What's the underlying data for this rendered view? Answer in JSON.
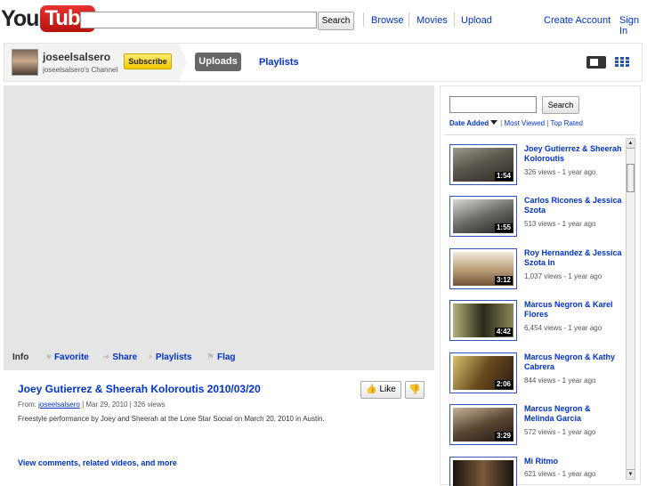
{
  "header": {
    "logo_you": "You",
    "logo_tube": "Tube",
    "search_button": "Search",
    "nav": [
      "Browse",
      "Movies",
      "Upload"
    ],
    "create_account": "Create Account",
    "sign_in": "Sign In"
  },
  "channel": {
    "name": "joseelsalsero",
    "subtitle": "joseelsalsero's Channel",
    "subscribe": "Subscribe",
    "uploads_tab": "Uploads",
    "playlists_tab": "Playlists"
  },
  "video_tabs": {
    "info": "Info",
    "favorite": "Favorite",
    "share": "Share",
    "playlists": "Playlists",
    "flag": "Flag"
  },
  "video": {
    "title": "Joey Gutierrez & Sheerah Koloroutis 2010/03/20",
    "like": "Like",
    "from_label": "From:",
    "from_user": "joseelsalsero",
    "date": "| Mar 29, 2010 | 326 views",
    "description": "Freestyle performance by Joey and Sheerah at the Lone Star Social on March 20, 2010 in Austin.",
    "more_link": "View comments, related videos, and more"
  },
  "sidebar": {
    "search_button": "Search",
    "sort_active": "Date Added",
    "sort_most_viewed": "Most Viewed",
    "sort_top_rated": "Top Rated",
    "sort_sep": "|",
    "items": [
      {
        "title": "Joey Gutierrez & Sheerah Koloroutis",
        "meta": "326 views - 1 year ago",
        "duration": "1:54"
      },
      {
        "title": "Carlos Ricones & Jessica Szota",
        "meta": "513 views - 1 year ago",
        "duration": "1:55"
      },
      {
        "title": "Roy Hernandez & Jessica Szota In",
        "meta": "1,037 views - 1 year ago",
        "duration": "3:12"
      },
      {
        "title": "Marcus Negron & Karel Flores",
        "meta": "6,454 views - 1 year ago",
        "duration": "4:42"
      },
      {
        "title": "Marcus Negron & Kathy Cabrera",
        "meta": "844 views - 1 year ago",
        "duration": "2:06"
      },
      {
        "title": "Marcus Negron & Melinda Garcia",
        "meta": "572 views - 1 year ago",
        "duration": "3:29"
      },
      {
        "title": "Mi Ritmo",
        "meta": "621 views - 1 year ago",
        "duration": ""
      }
    ]
  },
  "colors": {
    "link": "#0033cc",
    "logo_red": "#cc181e",
    "subscribe_yellow": "#f4c900"
  },
  "icons": {
    "favorite": "heart-icon",
    "share": "arrow-icon",
    "playlists": "plus-icon",
    "flag": "flag-icon",
    "like": "thumbs-up-icon",
    "dislike": "thumbs-down-icon"
  }
}
